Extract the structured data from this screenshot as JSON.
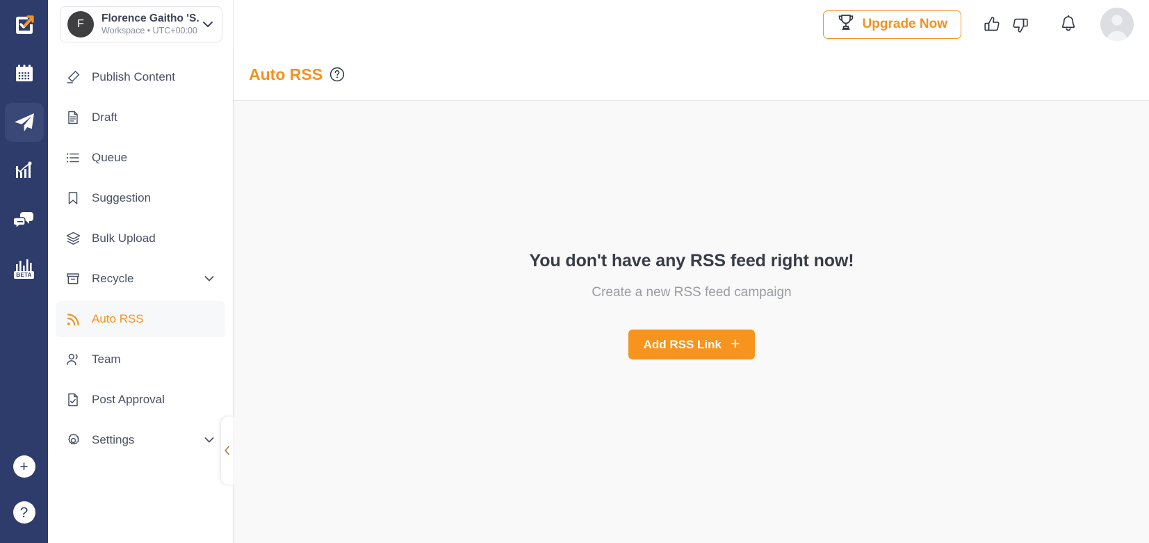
{
  "rail": {
    "icons": [
      {
        "name": "app-logo-icon",
        "label": "ContentStudio Logo"
      },
      {
        "name": "calendar-icon",
        "label": "Calendar"
      },
      {
        "name": "paper-plane-icon",
        "label": "Publish",
        "active": true
      },
      {
        "name": "analytics-chart-icon",
        "label": "Analytics"
      },
      {
        "name": "chat-bubbles-icon",
        "label": "Inbox"
      },
      {
        "name": "bar-chart-beta-icon",
        "label": "Reports",
        "badge": "BETA"
      }
    ],
    "bottom": [
      {
        "name": "add-new-icon",
        "glyph": "+"
      },
      {
        "name": "help-icon",
        "glyph": "?"
      }
    ]
  },
  "workspace": {
    "avatar_initial": "F",
    "name": "Florence Gaitho 'S...",
    "subtitle": "Workspace • UTC+00:00",
    "caret_icon": "chevron-down-icon"
  },
  "sidebar": {
    "items": [
      {
        "label": "Publish Content",
        "icon": "pencil-icon",
        "active": false,
        "chevron": false
      },
      {
        "label": "Draft",
        "icon": "document-icon",
        "active": false,
        "chevron": false
      },
      {
        "label": "Queue",
        "icon": "list-icon",
        "active": false,
        "chevron": false
      },
      {
        "label": "Suggestion",
        "icon": "bookmark-icon",
        "active": false,
        "chevron": false
      },
      {
        "label": "Bulk Upload",
        "icon": "layers-icon",
        "active": false,
        "chevron": false
      },
      {
        "label": "Recycle",
        "icon": "archive-icon",
        "active": false,
        "chevron": true
      },
      {
        "label": "Auto RSS",
        "icon": "rss-icon",
        "active": true,
        "chevron": false
      },
      {
        "label": "Team",
        "icon": "users-icon",
        "active": false,
        "chevron": false
      },
      {
        "label": "Post Approval",
        "icon": "document-check-icon",
        "active": false,
        "chevron": false
      },
      {
        "label": "Settings",
        "icon": "gear-icon",
        "active": false,
        "chevron": true
      }
    ],
    "collapse_icon": "chevron-left-icon"
  },
  "topbar": {
    "upgrade_label": "Upgrade Now",
    "upgrade_icon": "trophy-icon",
    "thumbs_up_icon": "thumbs-up-icon",
    "thumbs_down_icon": "thumbs-down-icon",
    "bell_icon": "bell-icon",
    "avatar_icon": "user-avatar"
  },
  "page": {
    "title": "Auto RSS",
    "help_icon": "question-circle-icon"
  },
  "empty_state": {
    "title": "You don't have any RSS feed right now!",
    "subtitle": "Create a new RSS feed campaign",
    "button_label": "Add RSS Link",
    "button_plus": "+"
  },
  "colors": {
    "rail_bg": "#2e3c6b",
    "accent_orange": "#f5911e",
    "button_orange": "#f7941d",
    "content_bg": "#f9f9f9",
    "text_dark": "#383c47",
    "text_muted": "#9a9ca3"
  }
}
